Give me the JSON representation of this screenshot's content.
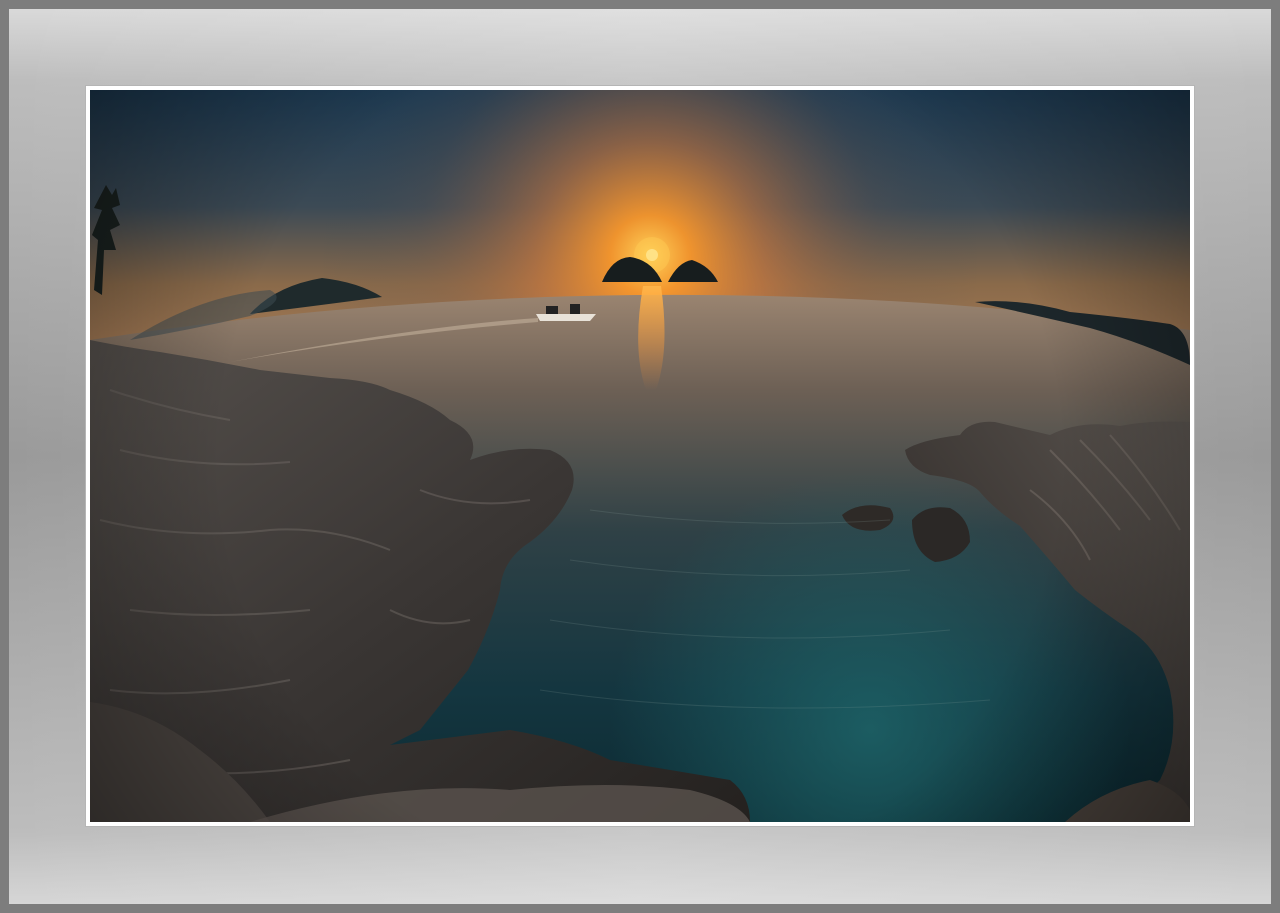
{
  "image": {
    "subject": "photo",
    "frame_color": "#8f8f8f",
    "colors": {
      "sky_top": "#1e3b52",
      "sky_glow": "#ffb040",
      "sun": "#fff4b0",
      "sea_far": "#8a7a6a",
      "sea_near": "#0f2e35",
      "rock": "#3a3634"
    }
  }
}
